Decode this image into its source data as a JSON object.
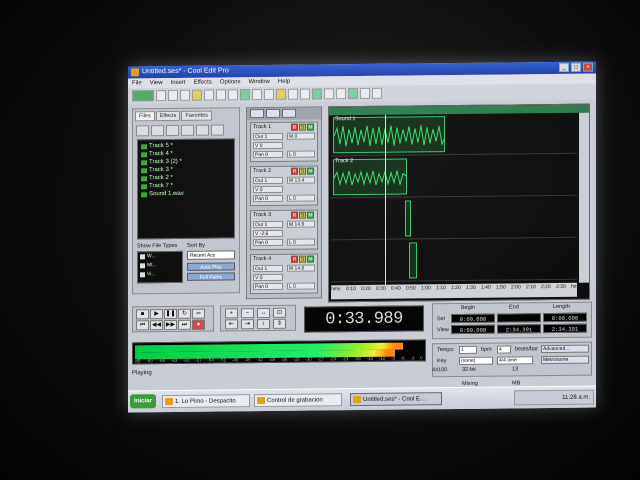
{
  "window": {
    "title": "Untitled.ses* - Cool Edit Pro"
  },
  "menu": [
    "File",
    "View",
    "Insert",
    "Effects",
    "Options",
    "Window",
    "Help"
  ],
  "organizer": {
    "tabs": [
      "Files",
      "Effects",
      "Favorites"
    ],
    "files": [
      "Track 5 *",
      "Track 4 *",
      "Track 3 (2) *",
      "Track 3 *",
      "Track 2 *",
      "Track 7 *",
      "Sound 1.wav"
    ],
    "show_file_types_label": "Show File Types",
    "sort_by_label": "Sort By",
    "file_types": [
      "W...",
      "MI...",
      "Vi..."
    ],
    "sort_value": "Recent Acc",
    "btn_auto_play": "Auto Play",
    "btn_full_paths": "Full Paths"
  },
  "tracks": [
    {
      "name": "Track 1",
      "io1": "Out 1",
      "vol": "V 0",
      "pan": "Pan 0",
      "m": "M 0",
      "l": "L 0"
    },
    {
      "name": "Track 2",
      "io1": "Out 1",
      "vol": "V 0",
      "pan": "Pan 0",
      "m": "M 13.4",
      "l": "L 0"
    },
    {
      "name": "Track 3",
      "io1": "Out 1",
      "vol": "V -2.6",
      "pan": "Pan 0",
      "m": "M 14.6",
      "l": "L 0"
    },
    {
      "name": "Track 4",
      "io1": "Out 1",
      "vol": "V 0",
      "pan": "Pan 0",
      "m": "M 14.6",
      "l": "L 0"
    }
  ],
  "lanes": [
    {
      "label": "Sound 1",
      "num": "1"
    },
    {
      "label": "Track 2",
      "num": "2"
    },
    {
      "label": "",
      "num": "3"
    },
    {
      "label": "",
      "num": "4"
    }
  ],
  "timeline_ticks": [
    "hms",
    "0:10",
    "0:20",
    "0:30",
    "0:40",
    "0:50",
    "1:00",
    "1:10",
    "1:20",
    "1:30",
    "1:40",
    "1:50",
    "2:00",
    "2:10",
    "2:20",
    "2:30",
    "hms"
  ],
  "time_display": "0:33.989",
  "selection": {
    "begin_label": "Begin",
    "end_label": "End",
    "length_label": "Length",
    "sel_label": "Sel",
    "view_label": "View",
    "sel_begin": "0:00.000",
    "sel_length": "0:00.000",
    "view_begin": "0:00.000",
    "view_end": "2:34.391",
    "view_length": "2:34.391"
  },
  "meter": {
    "level": 0.93,
    "scale": [
      "dB",
      "-69",
      "-66",
      "-63",
      "-60",
      "-57",
      "-54",
      "-51",
      "-48",
      "-45",
      "-42",
      "-39",
      "-36",
      "-33",
      "-30",
      "-27",
      "-24",
      "-21",
      "-18",
      "-15",
      "-12",
      "-9",
      "-6",
      "-3",
      "0"
    ]
  },
  "tempo": {
    "tempo_label": "Tempo",
    "tempo_value": "1",
    "bpm_label": "bpm",
    "beats_value": "4",
    "beats_label": "beats/bar",
    "key_label": "Key",
    "key_value": "(none)",
    "time_sig": "4/4 time",
    "btn_advanced": "Advanced...",
    "btn_metronome": "Metronome"
  },
  "status": {
    "text": "Playing",
    "rate": "44100",
    "bits": "32-bit Mixing",
    "free": "13 MB"
  },
  "taskbar": {
    "start": "Iniciar",
    "tasks": [
      "1. Lo Pimo - Despacito",
      "Control de grabacion",
      "Untitled.ses* - Cool E..."
    ],
    "clock": "11:28 a.m."
  }
}
